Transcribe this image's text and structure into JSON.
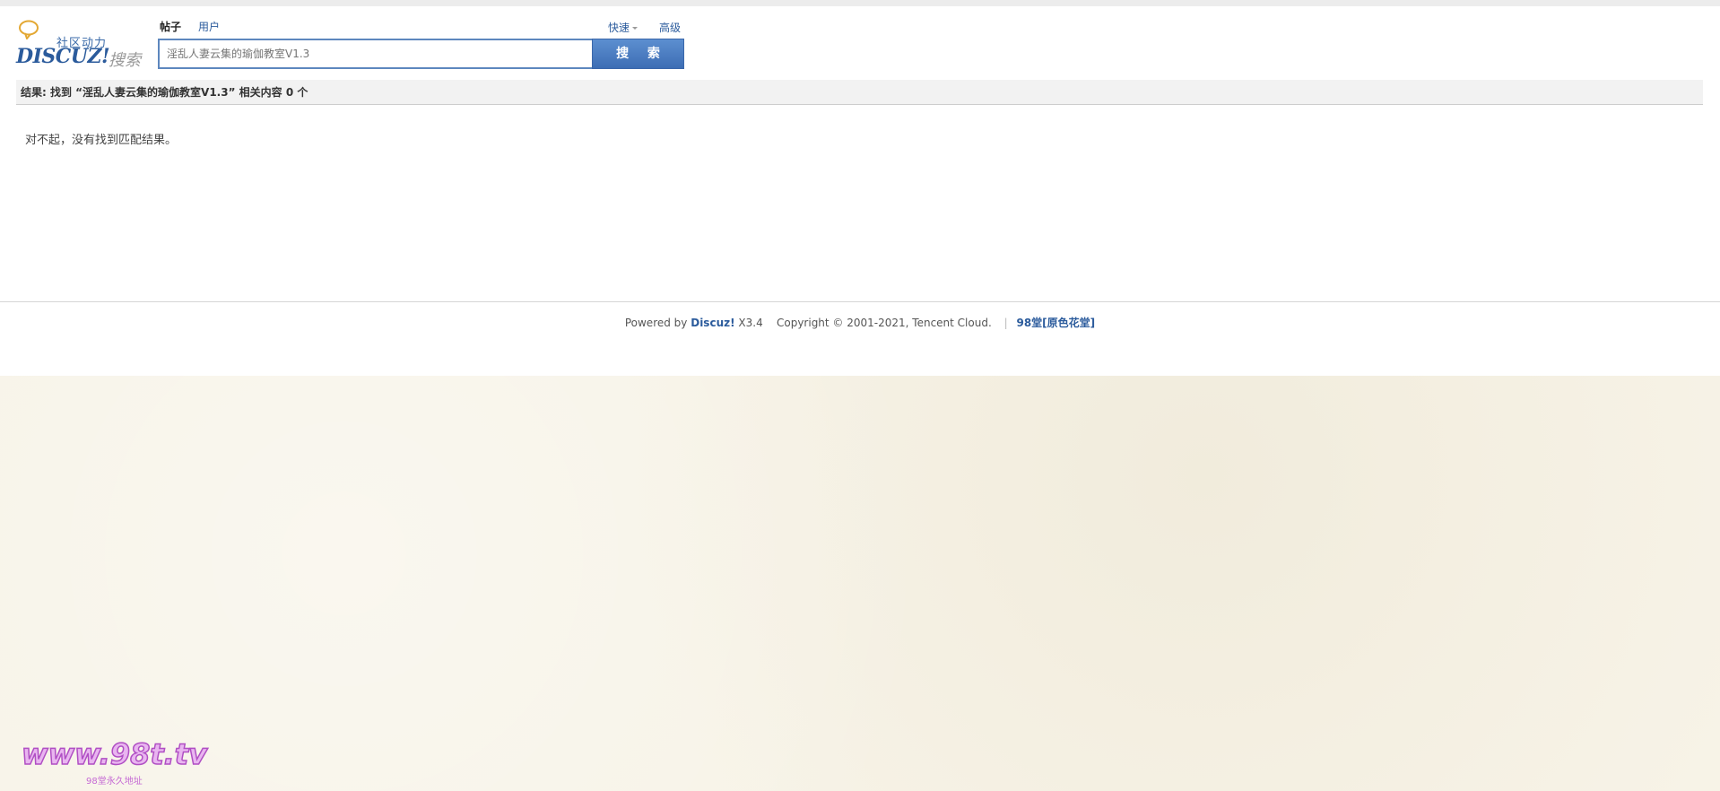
{
  "logo": {
    "slogan": "社区动力",
    "brand": "DISCUZ!",
    "search_word": "搜索"
  },
  "search": {
    "tabs": [
      {
        "label": "帖子",
        "active": true
      },
      {
        "label": "用户",
        "active": false
      }
    ],
    "query_value": "淫乱人妻云集的瑜伽教室V1.3",
    "button_label": "搜 索",
    "quick_label": "快速",
    "advanced_label": "高级"
  },
  "results": {
    "summary": "结果: 找到 “淫乱人妻云集的瑜伽教室V1.3” 相关内容 0 个",
    "empty_message": "对不起，没有找到匹配结果。"
  },
  "footer": {
    "powered_by": "Powered by",
    "brand": "Discuz!",
    "version": "X3.4",
    "copyright": "Copyright © 2001-2021, Tencent Cloud.",
    "site_link": "98堂[原色花堂]"
  },
  "watermark": {
    "main": "www.98t.tv",
    "sub": "98堂永久地址"
  },
  "colors": {
    "link": "#2b5b9c",
    "button": "#4a7cc2",
    "page_bg": "#f7f3e7"
  }
}
